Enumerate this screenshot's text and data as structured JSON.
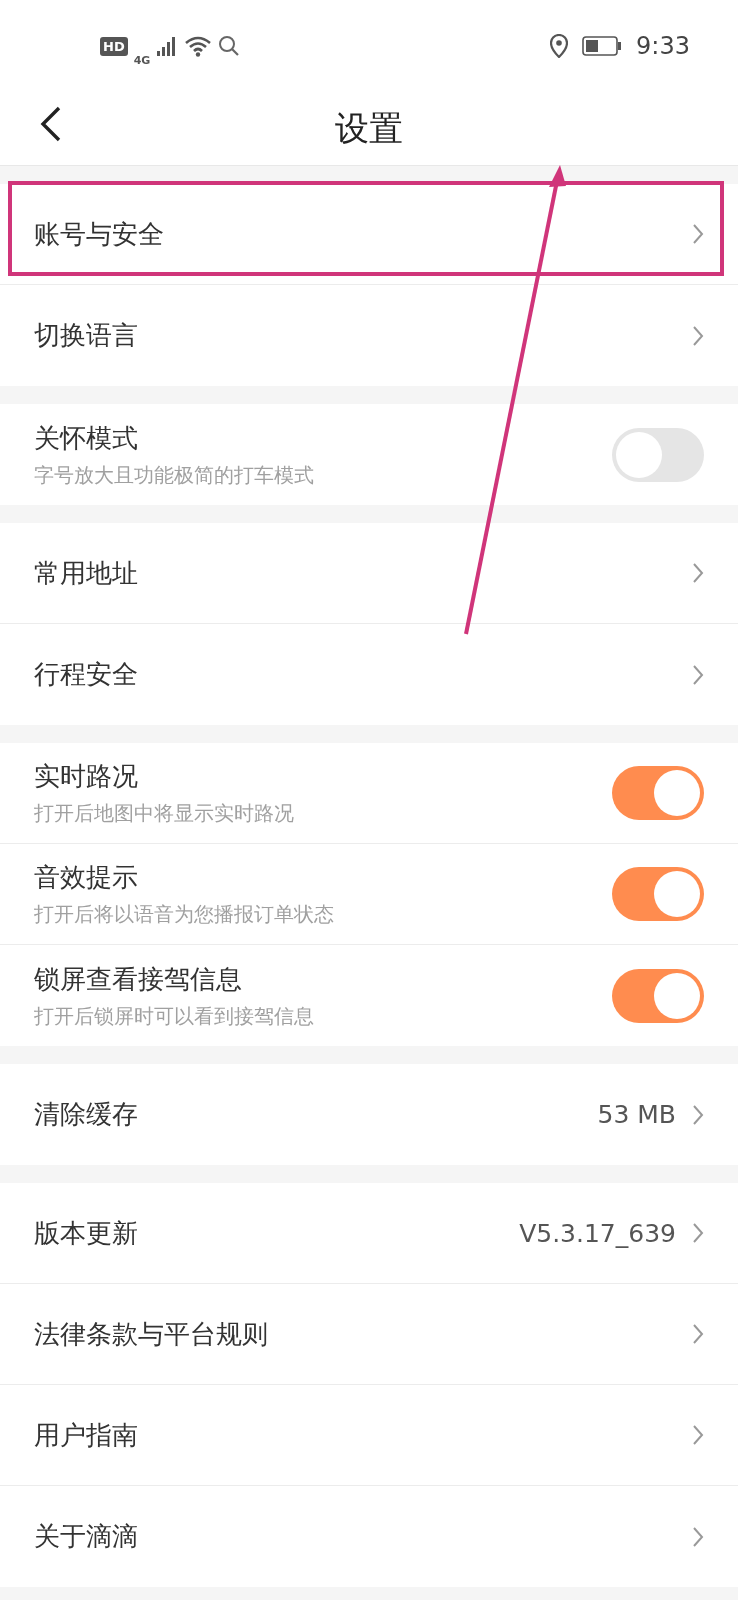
{
  "status_bar": {
    "hd": "HD",
    "network": "4G",
    "time": "9:33"
  },
  "header": {
    "title": "设置"
  },
  "groups": [
    {
      "rows": [
        {
          "kind": "link",
          "label": "账号与安全"
        },
        {
          "kind": "link",
          "label": "切换语言"
        }
      ]
    },
    {
      "rows": [
        {
          "kind": "toggle",
          "label": "关怀模式",
          "subtitle": "字号放大且功能极简的打车模式",
          "on": false
        }
      ]
    },
    {
      "rows": [
        {
          "kind": "link",
          "label": "常用地址"
        },
        {
          "kind": "link",
          "label": "行程安全"
        }
      ]
    },
    {
      "rows": [
        {
          "kind": "toggle",
          "label": "实时路况",
          "subtitle": "打开后地图中将显示实时路况",
          "on": true
        },
        {
          "kind": "toggle",
          "label": "音效提示",
          "subtitle": "打开后将以语音为您播报订单状态",
          "on": true
        },
        {
          "kind": "toggle",
          "label": "锁屏查看接驾信息",
          "subtitle": "打开后锁屏时可以看到接驾信息",
          "on": true
        }
      ]
    },
    {
      "rows": [
        {
          "kind": "link",
          "label": "清除缓存",
          "value": "53 MB"
        }
      ]
    },
    {
      "rows": [
        {
          "kind": "link",
          "label": "版本更新",
          "value": "V5.3.17_639"
        },
        {
          "kind": "link",
          "label": "法律条款与平台规则"
        },
        {
          "kind": "link",
          "label": "用户指南"
        },
        {
          "kind": "link",
          "label": "关于滴滴"
        }
      ]
    }
  ]
}
